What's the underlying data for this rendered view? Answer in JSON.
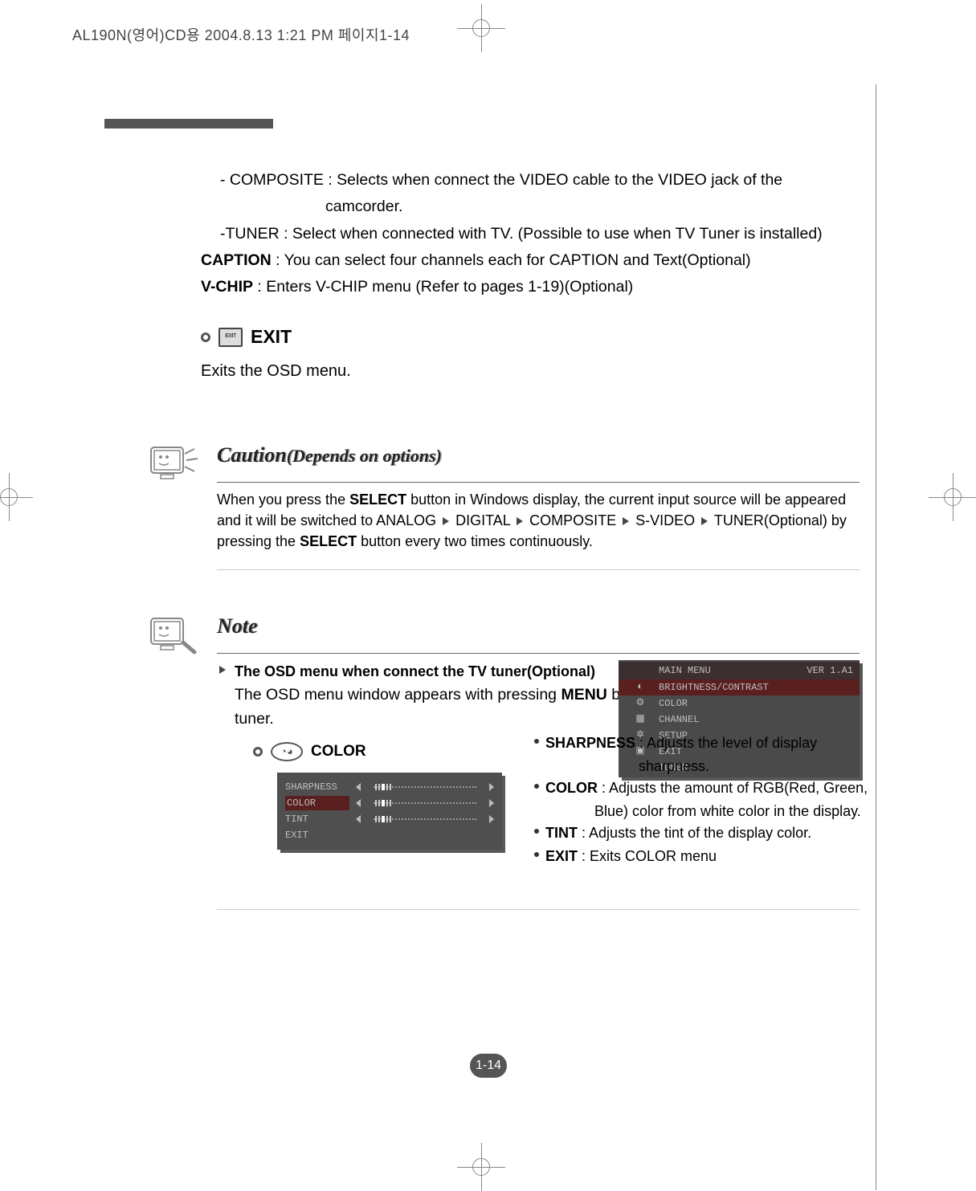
{
  "header": {
    "filename_line": "AL190N(영어)CD용  2004.8.13 1:21 PM  페이지1-14"
  },
  "body": {
    "composite_line1": "- COMPOSITE : Selects when connect the VIDEO cable to the VIDEO jack of the",
    "composite_line2": "camcorder.",
    "tuner_line": "-TUNER : Select when connected with TV. (Possible to use when TV Tuner is installed)",
    "caption_label": "CAPTION",
    "caption_text": " : You can select four channels each for CAPTION and Text(Optional)",
    "vchip_label": "V-CHIP",
    "vchip_text": " : Enters V-CHIP menu (Refer to pages 1-19)(Optional)",
    "exit_icon": "EXIT",
    "exit_title": "EXIT",
    "exit_desc": "Exits the OSD menu."
  },
  "caution": {
    "title": "Caution",
    "subtitle": "(Depends on options)",
    "text_before": "When you press the ",
    "select1": "SELECT",
    "text_mid1": " button in Windows display, the current input source will be appeared and it will be switched to ANALOG ",
    "seq_digital": " DIGITAL ",
    "seq_composite": " COMPOSITE ",
    "seq_svideo": " S-VIDEO ",
    "seq_tuner": " TUNER(Optional) by pressing the ",
    "select2": "SELECT",
    "text_end": " button every two times continuously."
  },
  "note": {
    "title": "Note",
    "lead_bold": "The OSD menu when connect the TV tuner(Optional)",
    "lead_cont1": "The OSD menu window appears with pressing ",
    "menu_bold": "MENU",
    "lead_cont2": " button after connecting the TV tuner.",
    "color_label": "COLOR"
  },
  "menu_panel": {
    "header_left": "MAIN MENU",
    "header_right": "VER 1.A1",
    "highlight": "BRIGHTNESS/CONTRAST",
    "items": [
      "COLOR",
      "CHANNEL",
      "SETUP",
      "EXIT",
      "TUNER"
    ]
  },
  "sub_panel": {
    "rows": [
      {
        "label": "SHARPNESS",
        "slider": true,
        "hl": false
      },
      {
        "label": "COLOR",
        "slider": true,
        "hl": true
      },
      {
        "label": "TINT",
        "slider": true,
        "hl": false
      },
      {
        "label": "EXIT",
        "slider": false,
        "hl": false
      }
    ]
  },
  "bullets": {
    "sharpness_label": "SHARPNESS",
    "sharpness_text": " : Adjusts  the level of display",
    "sharpness_cont": "sharpness.",
    "color_label": "COLOR",
    "color_text": " : Adjusts the amount of RGB(Red, Green,",
    "color_cont": "Blue) color from white color in the display.",
    "tint_label": "TINT",
    "tint_text": " : Adjusts the tint of the display color.",
    "exit_label": "EXIT",
    "exit_text": " : Exits COLOR menu"
  },
  "page_number": "1-14"
}
